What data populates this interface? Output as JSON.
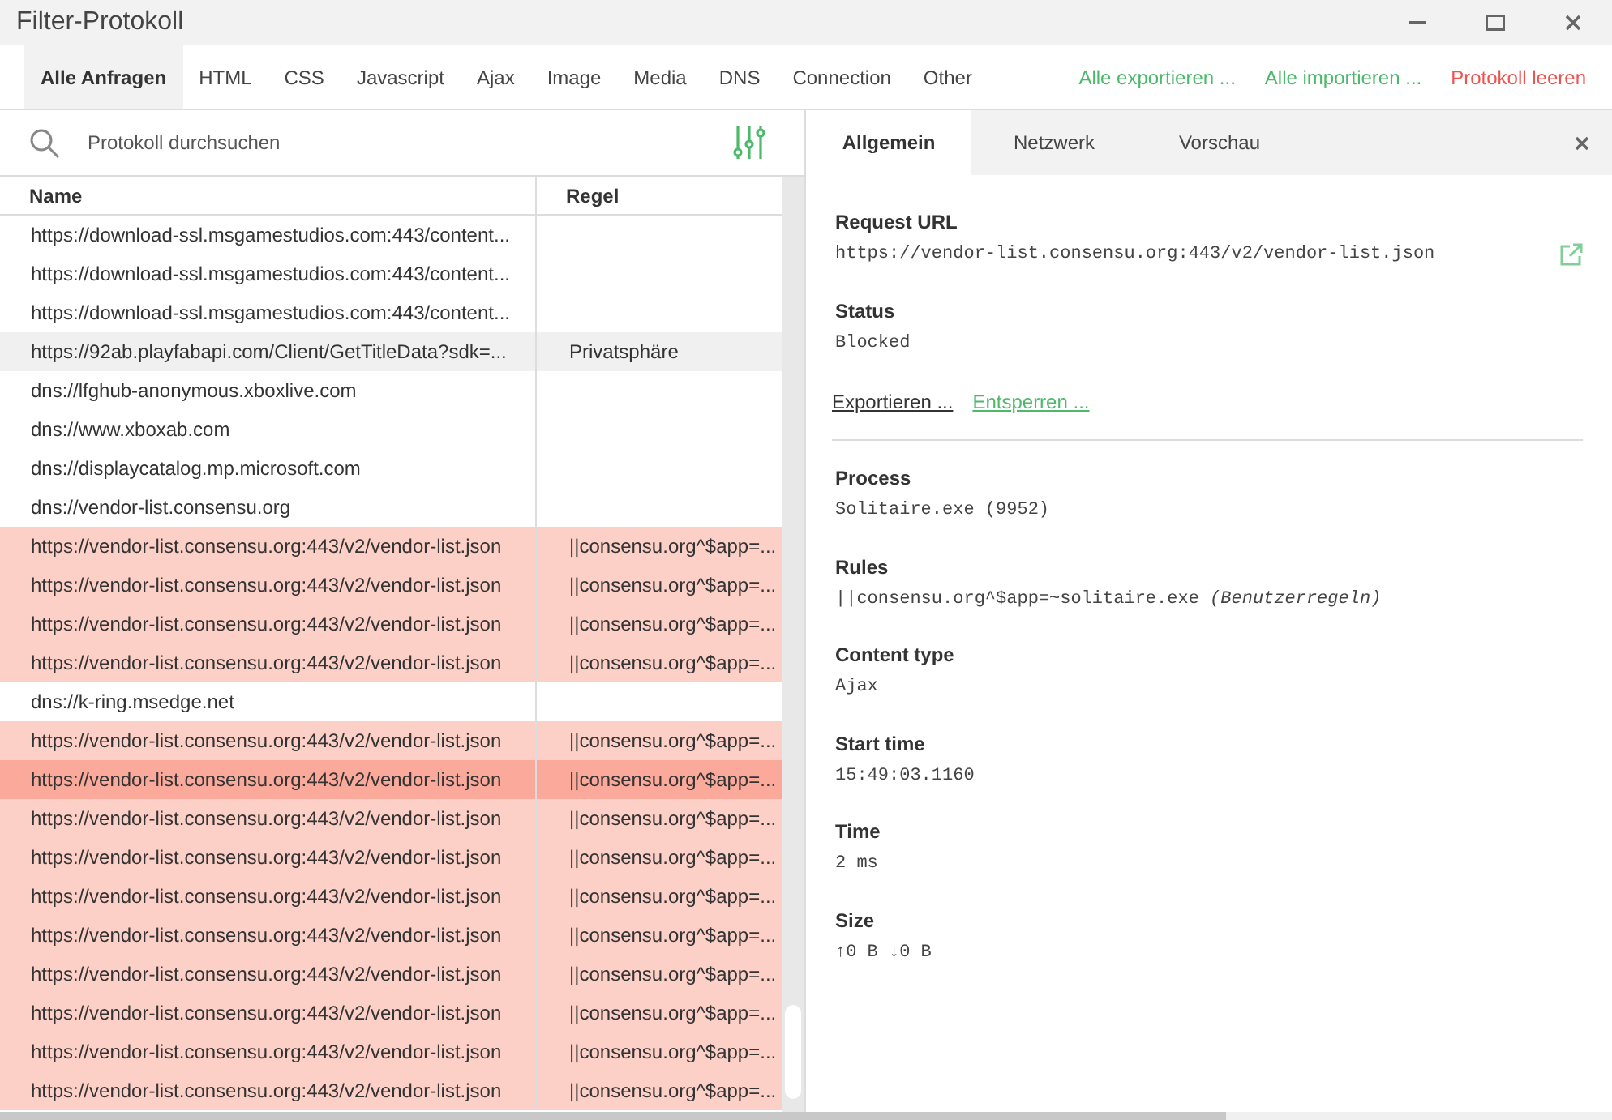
{
  "window": {
    "title": "Filter-Protokoll"
  },
  "tabs": [
    {
      "label": "Alle Anfragen",
      "selected": true
    },
    {
      "label": "HTML",
      "selected": false
    },
    {
      "label": "CSS",
      "selected": false
    },
    {
      "label": "Javascript",
      "selected": false
    },
    {
      "label": "Ajax",
      "selected": false
    },
    {
      "label": "Image",
      "selected": false
    },
    {
      "label": "Media",
      "selected": false
    },
    {
      "label": "DNS",
      "selected": false
    },
    {
      "label": "Connection",
      "selected": false
    },
    {
      "label": "Other",
      "selected": false
    }
  ],
  "actions": [
    {
      "label": "Alle exportieren ...",
      "kind": "positive"
    },
    {
      "label": "Alle importieren ...",
      "kind": "positive"
    },
    {
      "label": "Protokoll leeren",
      "kind": "danger"
    }
  ],
  "search": {
    "placeholder": "Protokoll durchsuchen"
  },
  "table": {
    "columns": [
      "Name",
      "Regel"
    ],
    "rows": [
      {
        "name": "https://download-ssl.msgamestudios.com:443/content...",
        "rule": "",
        "blocked": false,
        "hovered": false,
        "selected": false
      },
      {
        "name": "https://download-ssl.msgamestudios.com:443/content...",
        "rule": "",
        "blocked": false,
        "hovered": false,
        "selected": false
      },
      {
        "name": "https://download-ssl.msgamestudios.com:443/content...",
        "rule": "",
        "blocked": false,
        "hovered": false,
        "selected": false
      },
      {
        "name": "https://92ab.playfabapi.com/Client/GetTitleData?sdk=...",
        "rule": "Privatsphäre",
        "blocked": false,
        "hovered": true,
        "selected": false
      },
      {
        "name": "dns://lfghub-anonymous.xboxlive.com",
        "rule": "",
        "blocked": false,
        "hovered": false,
        "selected": false
      },
      {
        "name": "dns://www.xboxab.com",
        "rule": "",
        "blocked": false,
        "hovered": false,
        "selected": false
      },
      {
        "name": "dns://displaycatalog.mp.microsoft.com",
        "rule": "",
        "blocked": false,
        "hovered": false,
        "selected": false
      },
      {
        "name": "dns://vendor-list.consensu.org",
        "rule": "",
        "blocked": false,
        "hovered": false,
        "selected": false
      },
      {
        "name": "https://vendor-list.consensu.org:443/v2/vendor-list.json",
        "rule": "||consensu.org^$app=...",
        "blocked": true,
        "hovered": false,
        "selected": false
      },
      {
        "name": "https://vendor-list.consensu.org:443/v2/vendor-list.json",
        "rule": "||consensu.org^$app=...",
        "blocked": true,
        "hovered": false,
        "selected": false
      },
      {
        "name": "https://vendor-list.consensu.org:443/v2/vendor-list.json",
        "rule": "||consensu.org^$app=...",
        "blocked": true,
        "hovered": false,
        "selected": false
      },
      {
        "name": "https://vendor-list.consensu.org:443/v2/vendor-list.json",
        "rule": "||consensu.org^$app=...",
        "blocked": true,
        "hovered": false,
        "selected": false
      },
      {
        "name": "dns://k-ring.msedge.net",
        "rule": "",
        "blocked": false,
        "hovered": false,
        "selected": false
      },
      {
        "name": "https://vendor-list.consensu.org:443/v2/vendor-list.json",
        "rule": "||consensu.org^$app=...",
        "blocked": true,
        "hovered": false,
        "selected": false
      },
      {
        "name": "https://vendor-list.consensu.org:443/v2/vendor-list.json",
        "rule": "||consensu.org^$app=...",
        "blocked": true,
        "hovered": false,
        "selected": true
      },
      {
        "name": "https://vendor-list.consensu.org:443/v2/vendor-list.json",
        "rule": "||consensu.org^$app=...",
        "blocked": true,
        "hovered": false,
        "selected": false
      },
      {
        "name": "https://vendor-list.consensu.org:443/v2/vendor-list.json",
        "rule": "||consensu.org^$app=...",
        "blocked": true,
        "hovered": false,
        "selected": false
      },
      {
        "name": "https://vendor-list.consensu.org:443/v2/vendor-list.json",
        "rule": "||consensu.org^$app=...",
        "blocked": true,
        "hovered": false,
        "selected": false
      },
      {
        "name": "https://vendor-list.consensu.org:443/v2/vendor-list.json",
        "rule": "||consensu.org^$app=...",
        "blocked": true,
        "hovered": false,
        "selected": false
      },
      {
        "name": "https://vendor-list.consensu.org:443/v2/vendor-list.json",
        "rule": "||consensu.org^$app=...",
        "blocked": true,
        "hovered": false,
        "selected": false
      },
      {
        "name": "https://vendor-list.consensu.org:443/v2/vendor-list.json",
        "rule": "||consensu.org^$app=...",
        "blocked": true,
        "hovered": false,
        "selected": false
      },
      {
        "name": "https://vendor-list.consensu.org:443/v2/vendor-list.json",
        "rule": "||consensu.org^$app=...",
        "blocked": true,
        "hovered": false,
        "selected": false
      },
      {
        "name": "https://vendor-list.consensu.org:443/v2/vendor-list.json",
        "rule": "||consensu.org^$app=...",
        "blocked": true,
        "hovered": false,
        "selected": false
      }
    ]
  },
  "details": {
    "tabs": [
      {
        "label": "Allgemein",
        "selected": true
      },
      {
        "label": "Netzwerk",
        "selected": false
      },
      {
        "label": "Vorschau",
        "selected": false
      }
    ],
    "top_fields": [
      {
        "label": "Request URL",
        "value": "https://vendor-list.consensu.org:443/v2/vendor-list.json"
      },
      {
        "label": "Status",
        "value": "Blocked"
      }
    ],
    "links": [
      {
        "label": "Exportieren ...",
        "kind": "neutral"
      },
      {
        "label": "Entsperren ...",
        "kind": "positive"
      }
    ],
    "fields": [
      {
        "label": "Process",
        "value": "Solitaire.exe (9952)"
      },
      {
        "label": "Rules",
        "value": "||consensu.org^$app=~solitaire.exe *(Benutzerregeln)*"
      },
      {
        "label": "Content type",
        "value": "Ajax"
      },
      {
        "label": "Start time",
        "value": "15:49:03.1160"
      },
      {
        "label": "Time",
        "value": "2 ms"
      },
      {
        "label": "Size",
        "value": "↑0 B ↓0 B"
      }
    ]
  }
}
